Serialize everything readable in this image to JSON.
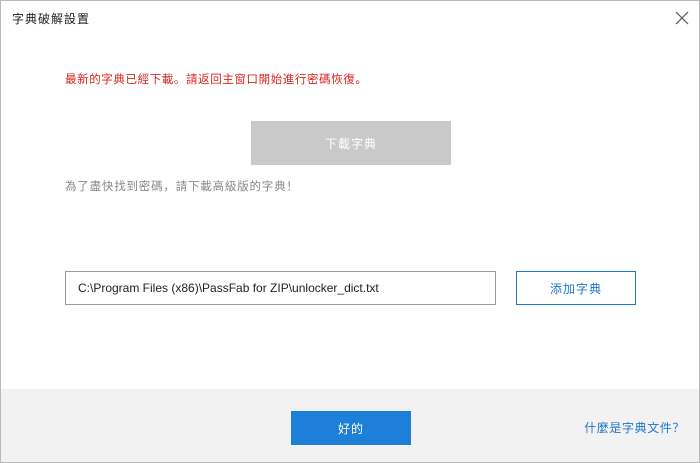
{
  "window": {
    "title": "字典破解設置"
  },
  "content": {
    "status_message": "最新的字典已經下載。請返回主窗口開始進行密碼恢復。",
    "download_button_label": "下載字典",
    "hint_message": "為了盡快找到密碼，請下載高級版的字典！",
    "dict_path_value": "C:\\Program Files (x86)\\PassFab for ZIP\\unlocker_dict.txt",
    "add_dict_button_label": "添加字典"
  },
  "footer": {
    "ok_button_label": "好的",
    "help_link_label": "什麼是字典文件？"
  },
  "icons": {
    "close": "close-icon"
  },
  "colors": {
    "error_text": "#d9241e",
    "accent": "#1e7fd8",
    "link": "#1e78c8",
    "disabled_button": "#c9c9c9",
    "hint_text": "#888888",
    "footer_bg": "#f2f2f2"
  }
}
